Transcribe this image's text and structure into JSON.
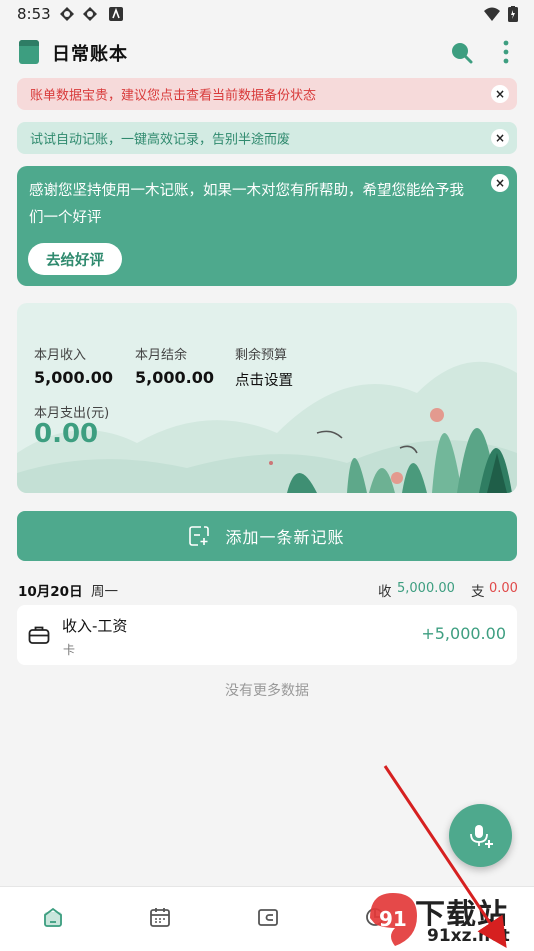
{
  "status_bar": {
    "time": "8:53"
  },
  "app_bar": {
    "title": "日常账本"
  },
  "notices": {
    "backup": "账单数据宝贵，建议您点击查看当前数据备份状态",
    "auto": "试试自动记账，一键高效记录，告别半途而废",
    "close_symbol": "×"
  },
  "rate_card": {
    "text": "感谢您坚持使用一木记账，如果一木对您有所帮助，希望您能给予我们一个好评",
    "button": "去给好评"
  },
  "summary": {
    "income_label": "本月收入",
    "income_value": "5,000.00",
    "balance_label": "本月结余",
    "balance_value": "5,000.00",
    "budget_label": "剩余预算",
    "budget_value": "点击设置",
    "expense_label": "本月支出(元)",
    "expense_value": "0.00"
  },
  "add_button": {
    "label": "添加一条新记账"
  },
  "day_group": {
    "date": "10月20日",
    "weekday": "周一",
    "income_label": "收",
    "income_value": "5,000.00",
    "expense_label": "支",
    "expense_value": "0.00",
    "records": [
      {
        "title": "收入-工资",
        "account": "卡",
        "amount": "+5,000.00"
      }
    ]
  },
  "no_more": "没有更多数据",
  "watermark": {
    "big": "下载站",
    "small": "91xz.net",
    "logo": "91"
  },
  "colors": {
    "accent": "#4ea98d",
    "income": "#3d9e80",
    "expense": "#e04a4a",
    "warn": "#d83a3a"
  }
}
